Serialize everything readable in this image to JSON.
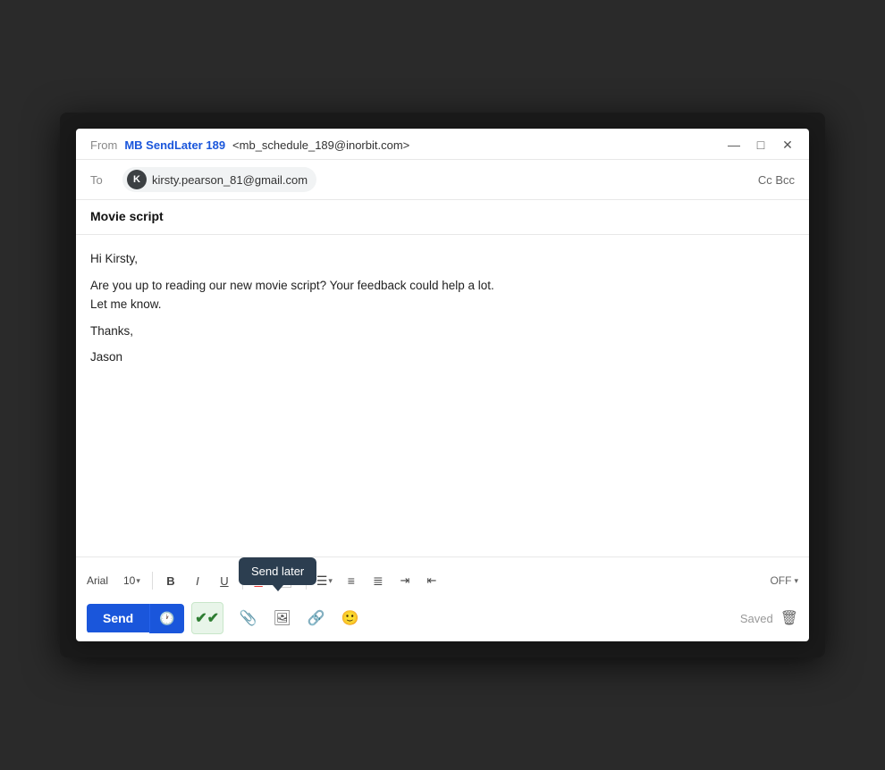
{
  "titlebar": {
    "from_label": "From",
    "sender_name": "MB SendLater 189",
    "sender_email": "<mb_schedule_189@inorbit.com>",
    "controls": {
      "minimize": "—",
      "maximize": "□",
      "close": "✕"
    }
  },
  "to_row": {
    "label": "To",
    "recipient_avatar": "K",
    "recipient_email": "kirsty.pearson_81@gmail.com",
    "cc_bcc": "Cc Bcc"
  },
  "subject": "Movie script",
  "body": {
    "line1": "Hi Kirsty,",
    "line2": "Are you up to reading our new movie script? Your feedback could help a lot.",
    "line3": "Let me know.",
    "line4": "Thanks,",
    "line5": "Jason"
  },
  "toolbar": {
    "font_name": "Arial",
    "font_size": "10",
    "bold": "B",
    "italic": "I",
    "underline": "U",
    "off_label": "OFF",
    "send_label": "Send",
    "saved_label": "Saved"
  },
  "tooltip": {
    "send_later": "Send later"
  }
}
